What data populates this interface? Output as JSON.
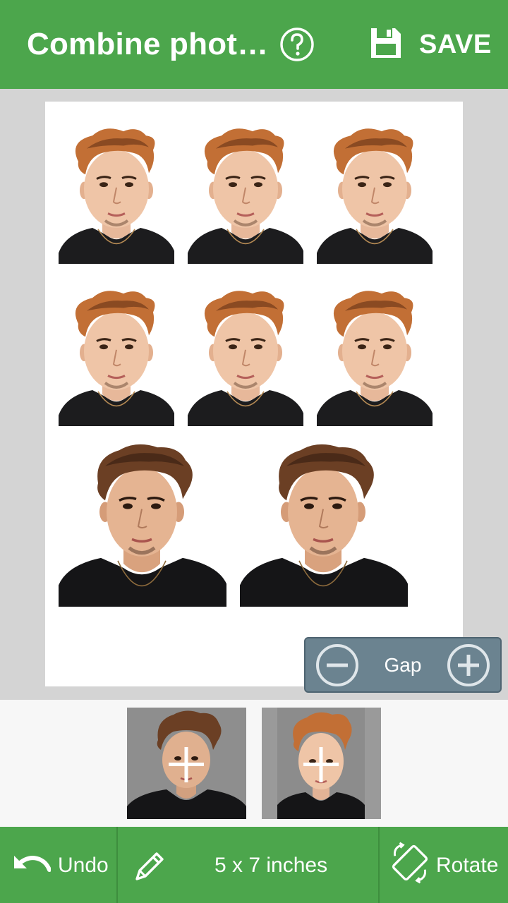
{
  "appbar": {
    "title": "Combine phot…",
    "help_icon": "help-circle-icon",
    "save_label": "SAVE",
    "save_icon": "floppy-disk-icon"
  },
  "sheet": {
    "photos": [
      {
        "type": "small"
      },
      {
        "type": "small"
      },
      {
        "type": "small"
      },
      {
        "type": "small"
      },
      {
        "type": "small"
      },
      {
        "type": "small"
      },
      {
        "type": "large"
      },
      {
        "type": "large"
      }
    ]
  },
  "gap_control": {
    "label": "Gap",
    "decrease_icon": "minus-circle-icon",
    "increase_icon": "plus-circle-icon"
  },
  "thumbnails": [
    {
      "style": "large-crop",
      "add_icon": "plus-icon"
    },
    {
      "style": "small-crop",
      "add_icon": "plus-icon"
    }
  ],
  "bottombar": {
    "undo_label": "Undo",
    "undo_icon": "undo-arrow-icon",
    "edit_icon": "pencil-icon",
    "paper_size": "5 x 7 inches",
    "rotate_label": "Rotate",
    "rotate_icon": "rotate-icon"
  },
  "colors": {
    "primary": "#4ca64c",
    "canvas_bg": "#d4d4d4",
    "gap_bg": "#6b8390"
  }
}
